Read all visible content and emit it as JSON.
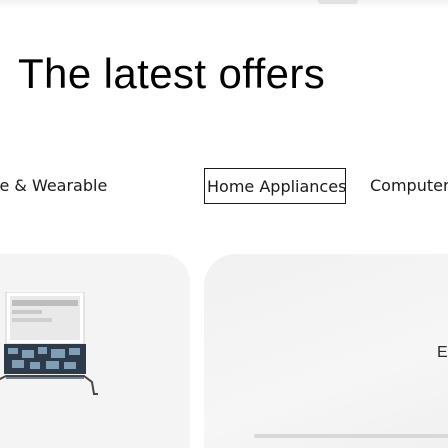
{
  "heading": "The latest offers",
  "tabs": [
    {
      "label": "le & Wearable",
      "active": false
    },
    {
      "label": "Home Appliances",
      "active": true
    },
    {
      "label": "Computer Mo",
      "active": false
    }
  ],
  "cards": [
    {
      "image_icon": "laptop-product-image"
    },
    {
      "partial_text": "E",
      "image_icon": "monitor-product-image"
    }
  ],
  "colors": {
    "text": "#111111",
    "card_background": "#f4f4f4",
    "active_tab_border": "#1a1a1a",
    "page_background": "#ffffff"
  }
}
